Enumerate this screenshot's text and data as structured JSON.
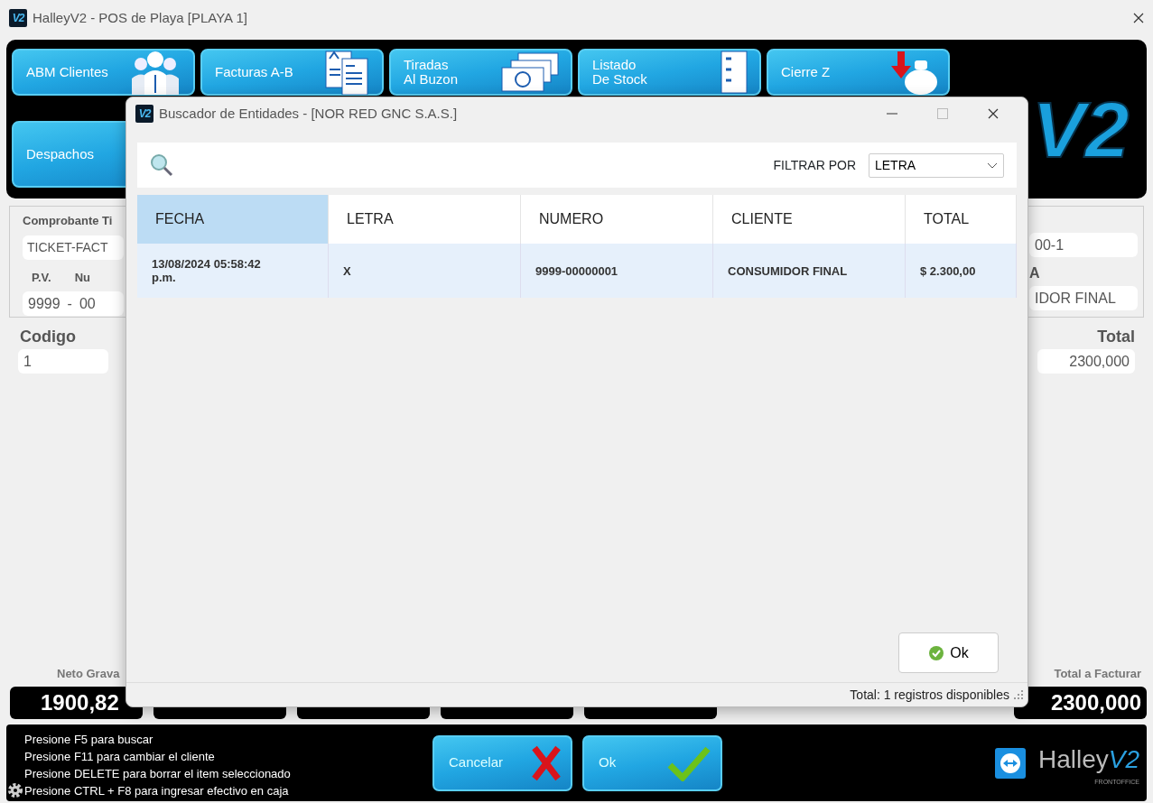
{
  "window": {
    "icon_text": "V2",
    "title": "HalleyV2 - POS de Playa [PLAYA 1]"
  },
  "toolbar": {
    "buttons": [
      {
        "lines": [
          "ABM Clientes"
        ]
      },
      {
        "lines": [
          "Facturas A-B"
        ]
      },
      {
        "lines": [
          "Tiradas",
          "Al Buzon"
        ]
      },
      {
        "lines": [
          "Listado",
          "De Stock"
        ]
      },
      {
        "lines": [
          "Cierre Z"
        ]
      },
      {
        "lines": [
          "Despachos"
        ]
      }
    ],
    "logo": "V2"
  },
  "form": {
    "left": [
      {
        "label": "Comprobante Ti",
        "fields": [
          "TICKET-FACT"
        ]
      },
      {
        "labels": [
          "P.V.",
          "Nu"
        ],
        "fields": [
          "9999",
          "-",
          "00"
        ]
      }
    ],
    "right": [
      {
        "value": "00-1"
      },
      {
        "label": "A",
        "value": "IDOR FINAL"
      }
    ],
    "codigo": {
      "label": "Codigo",
      "value": "1"
    },
    "total": {
      "label": "Total",
      "value": "2300,000"
    }
  },
  "totals": {
    "first": {
      "label": "Neto Grava",
      "value": "1900,82"
    },
    "grand": {
      "label": "Total a Facturar",
      "value": "2300,000"
    }
  },
  "footer": {
    "hints": [
      "Presione F5 para buscar",
      "Presione F11 para cambiar el cliente",
      "Presione DELETE para borrar el item seleccionado",
      "Presione CTRL + F8 para ingresar efectivo en caja"
    ],
    "buttons": [
      {
        "label": "Cancelar",
        "kind": "cancel"
      },
      {
        "label": "Ok",
        "kind": "ok"
      }
    ],
    "logo": {
      "name": "Halley",
      "version": "V2",
      "tagline": "FRONTOFFICE"
    }
  },
  "dialog": {
    "icon_text": "V2",
    "title": "Buscador de Entidades - [NOR RED GNC S.A.S.]",
    "filter_label": "FILTRAR POR",
    "filter_value": "LETRA",
    "columns": [
      {
        "label": "FECHA",
        "selected": true
      },
      {
        "label": "LETRA",
        "selected": false
      },
      {
        "label": "NUMERO",
        "selected": false
      },
      {
        "label": "CLIENTE",
        "selected": false
      },
      {
        "label": "TOTAL",
        "selected": false
      }
    ],
    "rows": [
      {
        "cells": [
          "13/08/2024 05:58:42 p.m.",
          "X",
          "9999-00000001",
          "CONSUMIDOR FINAL",
          "$ 2.300,00"
        ],
        "selected": true
      }
    ],
    "ok_button": "Ok",
    "status": "Total: 1 registros disponibles"
  }
}
